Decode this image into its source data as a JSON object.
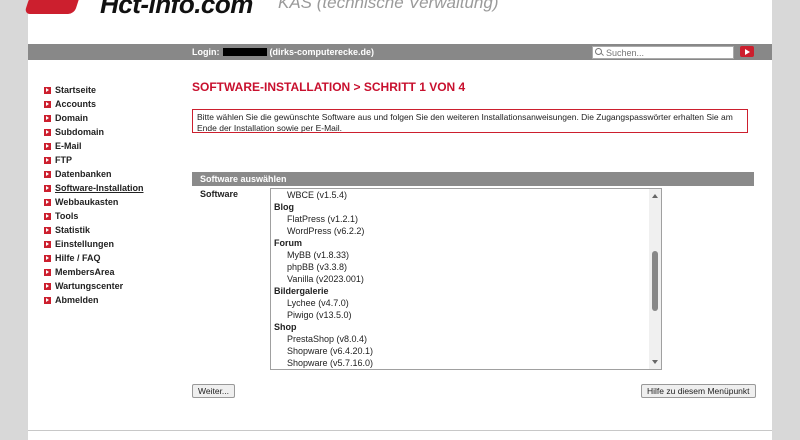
{
  "header": {
    "logo_text": "Hct-info.com",
    "logo_subtitle": "KAS (technische Verwaltung)",
    "login_label": "Login:",
    "login_domain": "(dirks-computerecke.de)",
    "search_placeholder": "Suchen..."
  },
  "sidebar": {
    "items": [
      {
        "label": "Startseite"
      },
      {
        "label": "Accounts"
      },
      {
        "label": "Domain"
      },
      {
        "label": "Subdomain"
      },
      {
        "label": "E-Mail"
      },
      {
        "label": "FTP"
      },
      {
        "label": "Datenbanken"
      },
      {
        "label": "Software-Installation"
      },
      {
        "label": "Webbaukasten"
      },
      {
        "label": "Tools"
      },
      {
        "label": "Statistik"
      },
      {
        "label": "Einstellungen"
      },
      {
        "label": "Hilfe / FAQ"
      },
      {
        "label": "MembersArea"
      },
      {
        "label": "Wartungscenter"
      },
      {
        "label": "Abmelden"
      }
    ]
  },
  "main": {
    "title": "SOFTWARE-INSTALLATION > SCHRITT 1 VON 4",
    "notice": "Bitte wählen Sie die gewünschte Software aus und folgen Sie den weiteren Installationsanweisungen. Die Zugangspasswörter erhalten Sie am Ende der Installation sowie per E-Mail.",
    "section_title": "Software auswählen",
    "field_label": "Software",
    "options": [
      {
        "label": "WBCE (v1.5.4)",
        "group": false
      },
      {
        "label": "Blog",
        "group": true
      },
      {
        "label": "FlatPress (v1.2.1)",
        "group": false
      },
      {
        "label": "WordPress (v6.2.2)",
        "group": false
      },
      {
        "label": "Forum",
        "group": true
      },
      {
        "label": "MyBB (v1.8.33)",
        "group": false
      },
      {
        "label": "phpBB (v3.3.8)",
        "group": false
      },
      {
        "label": "Vanilla (v2023.001)",
        "group": false
      },
      {
        "label": "Bildergalerie",
        "group": true
      },
      {
        "label": "Lychee (v4.7.0)",
        "group": false
      },
      {
        "label": "Piwigo (v13.5.0)",
        "group": false
      },
      {
        "label": "Shop",
        "group": true
      },
      {
        "label": "PrestaShop (v8.0.4)",
        "group": false
      },
      {
        "label": "Shopware (v6.4.20.1)",
        "group": false
      },
      {
        "label": "Shopware (v5.7.16.0)",
        "group": false
      }
    ],
    "next_button": "Weiter...",
    "help_button": "Hilfe zu diesem Menüpunkt"
  },
  "colors": {
    "accent": "#cc1f2e",
    "bar_gray": "#888888"
  }
}
